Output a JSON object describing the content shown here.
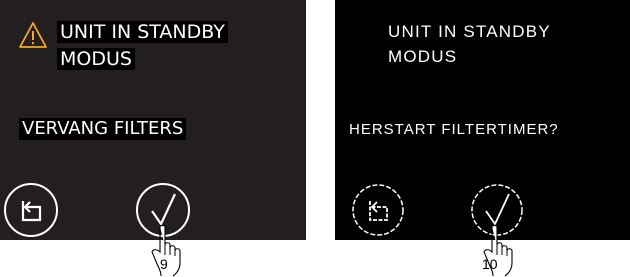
{
  "screen_left": {
    "title_line1": "UNIT IN STANDBY",
    "title_line2": "MODUS",
    "instruction": "VERVANG FILTERS",
    "warning_icon": "warning-triangle-icon",
    "back_icon": "back-arrow-icon",
    "confirm_icon": "checkmark-icon"
  },
  "screen_right": {
    "title_line1": "UNIT IN STANDBY",
    "title_line2": "MODUS",
    "instruction": "HERSTART FILTERTIMER?",
    "back_icon": "back-arrow-icon",
    "confirm_icon": "checkmark-icon"
  },
  "steps": {
    "left_step": "9",
    "right_step": "10"
  },
  "colors": {
    "screen_left_bg": "#231f20",
    "screen_right_bg": "#000000",
    "warning": "#f7a823",
    "text": "#ffffff"
  }
}
